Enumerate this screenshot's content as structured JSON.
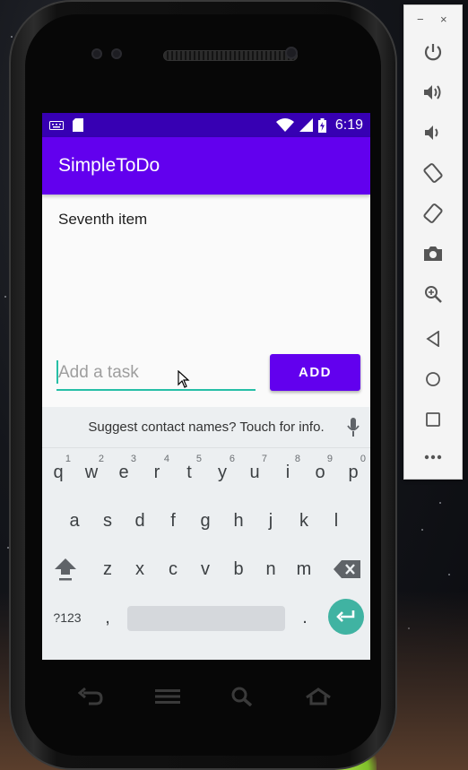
{
  "status_bar": {
    "time": "6:19",
    "icons": [
      "keyboard-icon",
      "sd-card-icon",
      "wifi-icon",
      "signal-icon",
      "battery-icon"
    ]
  },
  "app": {
    "title": "SimpleToDo",
    "accent_color": "#6200ee",
    "status_color": "#3700b3",
    "input_underline_color": "#26bfa6",
    "items": [
      {
        "label": "Seventh item"
      }
    ],
    "task_input": {
      "value": "",
      "placeholder": "Add a task"
    },
    "add_button_label": "ADD"
  },
  "keyboard": {
    "suggestion": "Suggest contact names? Touch for info.",
    "row1": [
      {
        "key": "q",
        "hint": "1"
      },
      {
        "key": "w",
        "hint": "2"
      },
      {
        "key": "e",
        "hint": "3"
      },
      {
        "key": "r",
        "hint": "4"
      },
      {
        "key": "t",
        "hint": "5"
      },
      {
        "key": "y",
        "hint": "6"
      },
      {
        "key": "u",
        "hint": "7"
      },
      {
        "key": "i",
        "hint": "8"
      },
      {
        "key": "o",
        "hint": "9"
      },
      {
        "key": "p",
        "hint": "0"
      }
    ],
    "row2": [
      "a",
      "s",
      "d",
      "f",
      "g",
      "h",
      "j",
      "k",
      "l"
    ],
    "row3": [
      "z",
      "x",
      "c",
      "v",
      "b",
      "n",
      "m"
    ],
    "symbols_label": "?123",
    "comma": ",",
    "period": ".",
    "enter_color": "#40b3a2"
  },
  "emulator_panel": {
    "minimize": "−",
    "close": "×",
    "tools": [
      "power-icon",
      "volume-up-icon",
      "volume-down-icon",
      "rotate-left-icon",
      "rotate-right-icon",
      "camera-icon",
      "zoom-icon",
      "back-icon",
      "home-icon",
      "overview-icon",
      "more-icon"
    ]
  }
}
